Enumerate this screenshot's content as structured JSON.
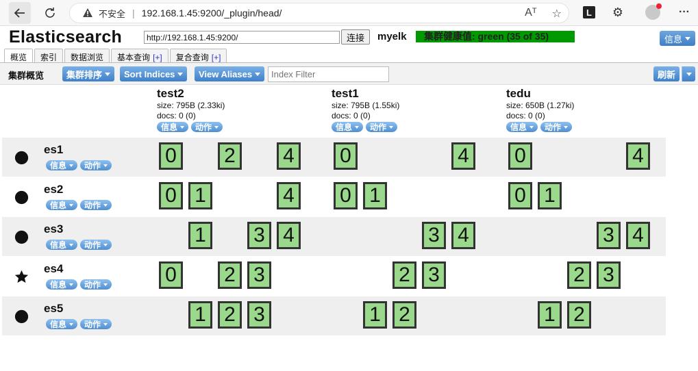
{
  "browser": {
    "insecure_label": "不安全",
    "url": "192.168.1.45:9200/_plugin/head/",
    "read_aloud_label": "Aᵀ",
    "ext_label": "L"
  },
  "app": {
    "title": "Elasticsearch",
    "connect_url": "http://192.168.1.45:9200/",
    "connect_label": "连接",
    "cluster_name": "myelk",
    "health": "集群健康值: green (35 of 35)",
    "health_color": "#009900",
    "info_label": "信息"
  },
  "tabs": [
    {
      "label": "概览",
      "plus": ""
    },
    {
      "label": "索引",
      "plus": ""
    },
    {
      "label": "数据浏览",
      "plus": ""
    },
    {
      "label": "基本查询",
      "plus": "[+]"
    },
    {
      "label": "复合查询",
      "plus": "[+]"
    }
  ],
  "toolbar": {
    "title": "集群概览",
    "sort_cluster": "集群排序",
    "sort_indices": "Sort Indices",
    "view_aliases": "View Aliases",
    "filter_placeholder": "Index Filter",
    "refresh": "刷新"
  },
  "buttons": {
    "info": "信息",
    "action": "动作"
  },
  "indices": [
    {
      "name": "test2",
      "size": "size: 795B (2.33ki)",
      "docs": "docs: 0 (0)"
    },
    {
      "name": "test1",
      "size": "size: 795B (1.55ki)",
      "docs": "docs: 0 (0)"
    },
    {
      "name": "tedu",
      "size": "size: 650B (1.27ki)",
      "docs": "docs: 0 (0)"
    }
  ],
  "nodes": [
    {
      "name": "es1",
      "icon": "circle",
      "shards": [
        [
          "0",
          "",
          "2",
          "",
          "4"
        ],
        [
          "0",
          "",
          "",
          "",
          "4"
        ],
        [
          "0",
          "",
          "",
          "",
          "4"
        ]
      ]
    },
    {
      "name": "es2",
      "icon": "circle",
      "shards": [
        [
          "0",
          "1",
          "",
          "",
          "4"
        ],
        [
          "0",
          "1",
          "",
          "",
          ""
        ],
        [
          "0",
          "1",
          "",
          "",
          ""
        ]
      ]
    },
    {
      "name": "es3",
      "icon": "circle",
      "shards": [
        [
          "",
          "1",
          "",
          "3",
          "4"
        ],
        [
          "",
          "",
          "",
          "3",
          "4"
        ],
        [
          "",
          "",
          "",
          "3",
          "4"
        ]
      ]
    },
    {
      "name": "es4",
      "icon": "star",
      "shards": [
        [
          "0",
          "",
          "2",
          "3",
          ""
        ],
        [
          "",
          "",
          "2",
          "3",
          ""
        ],
        [
          "",
          "",
          "2",
          "3",
          ""
        ]
      ]
    },
    {
      "name": "es5",
      "icon": "circle",
      "shards": [
        [
          "",
          "1",
          "2",
          "3",
          ""
        ],
        [
          "",
          "1",
          "2",
          "",
          ""
        ],
        [
          "",
          "1",
          "2",
          "",
          ""
        ]
      ]
    }
  ]
}
